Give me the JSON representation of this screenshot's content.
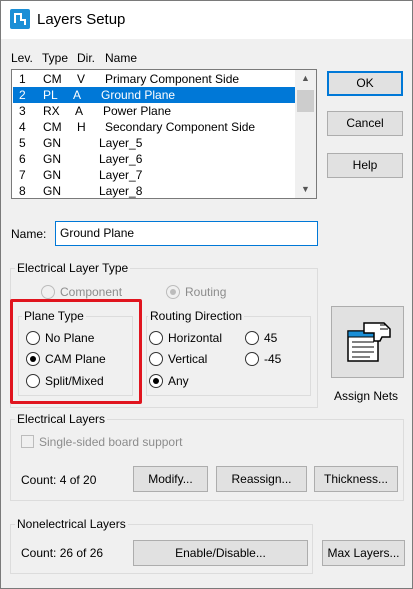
{
  "window": {
    "title": "Layers Setup"
  },
  "list": {
    "headers": {
      "lev": "Lev.",
      "type": "Type",
      "dir": "Dir.",
      "name": "Name"
    },
    "rows": [
      {
        "lev": "1",
        "type": "CM",
        "dir": "V",
        "name": "Primary Component Side"
      },
      {
        "lev": "2",
        "type": "PL",
        "dir": "A",
        "name": "Ground Plane"
      },
      {
        "lev": "3",
        "type": "RX",
        "dir": "A",
        "name": "Power Plane"
      },
      {
        "lev": "4",
        "type": "CM",
        "dir": "H",
        "name": "Secondary Component Side"
      },
      {
        "lev": "5",
        "type": "GN",
        "dir": "",
        "name": "Layer_5"
      },
      {
        "lev": "6",
        "type": "GN",
        "dir": "",
        "name": "Layer_6"
      },
      {
        "lev": "7",
        "type": "GN",
        "dir": "",
        "name": "Layer_7"
      },
      {
        "lev": "8",
        "type": "GN",
        "dir": "",
        "name": "Layer_8"
      }
    ],
    "selected_index": 1
  },
  "buttons": {
    "ok": "OK",
    "cancel": "Cancel",
    "help": "Help",
    "assign_nets": "Assign Nets",
    "modify": "Modify...",
    "reassign": "Reassign...",
    "thickness": "Thickness...",
    "enable_disable": "Enable/Disable...",
    "max_layers": "Max Layers..."
  },
  "name_field": {
    "label": "Name:",
    "value": "Ground Plane"
  },
  "electrical_layer_type": {
    "title": "Electrical  Layer Type",
    "component": "Component",
    "routing": "Routing",
    "selected": "routing"
  },
  "plane_type": {
    "title": "Plane Type",
    "options": [
      "No Plane",
      "CAM Plane",
      "Split/Mixed"
    ],
    "selected": "CAM Plane"
  },
  "routing_direction": {
    "title": "Routing Direction",
    "horizontal": "Horizontal",
    "vertical": "Vertical",
    "any": "Any",
    "deg45": "45",
    "degm45": "-45",
    "selected": "Any"
  },
  "electrical_layers": {
    "title": "Electrical Layers",
    "single_sided": "Single-sided board support",
    "count": "Count:  4 of 20"
  },
  "nonelectrical_layers": {
    "title": "Nonelectrical Layers",
    "count": "Count: 26 of 26"
  },
  "colors": {
    "selection": "#0078d7",
    "highlight": "#e0141e"
  }
}
